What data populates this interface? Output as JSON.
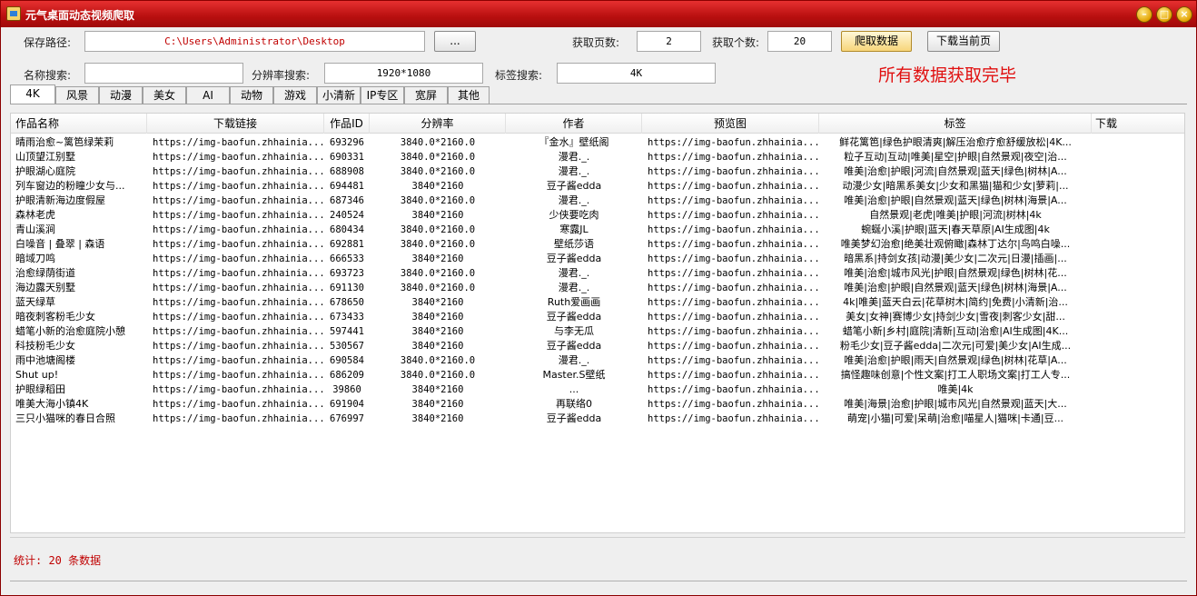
{
  "window": {
    "title": "元气桌面动态视频爬取"
  },
  "form": {
    "save_path_label": "保存路径:",
    "save_path_value": "C:\\Users\\Administrator\\Desktop",
    "browse_label": "...",
    "pages_label": "获取页数:",
    "pages_value": "2",
    "count_label": "获取个数:",
    "count_value": "20",
    "crawl_button": "爬取数据",
    "download_page_button": "下载当前页",
    "name_search_label": "名称搜索:",
    "name_search_value": "",
    "res_search_label": "分辨率搜索:",
    "res_search_value": "1920*1080",
    "tag_search_label": "标签搜索:",
    "tag_search_value": "4K",
    "status_message": "所有数据获取完毕"
  },
  "tabs": [
    "4K",
    "风景",
    "动漫",
    "美女",
    "AI",
    "动物",
    "游戏",
    "小清新",
    "IP专区",
    "宽屏",
    "其他"
  ],
  "selected_tab": "4K",
  "table": {
    "columns": [
      "作品名称",
      "下载链接",
      "作品ID",
      "分辨率",
      "作者",
      "预览图",
      "标签",
      "下载"
    ],
    "rows": [
      [
        "晴雨治愈~篱笆绿茉莉",
        "https://img-baofun.zhhainia...",
        "693296",
        "3840.0*2160.0",
        "『金水』壁纸阁",
        "https://img-baofun.zhhainia...",
        "鲜花篱笆|绿色护眼清爽|解压治愈疗愈舒缓放松|4K..."
      ],
      [
        "山顶望江别墅",
        "https://img-baofun.zhhainia...",
        "690331",
        "3840.0*2160.0",
        "漫君._.",
        "https://img-baofun.zhhainia...",
        "粒子互动|互动|唯美|星空|护眼|自然景观|夜空|治..."
      ],
      [
        "护眼湖心庭院",
        "https://img-baofun.zhhainia...",
        "688908",
        "3840.0*2160.0",
        "漫君._.",
        "https://img-baofun.zhhainia...",
        "唯美|治愈|护眼|河流|自然景观|蓝天|绿色|树林|A..."
      ],
      [
        "列车窗边的粉瞳少女与...",
        "https://img-baofun.zhhainia...",
        "694481",
        "3840*2160",
        "豆子酱edda",
        "https://img-baofun.zhhainia...",
        "动漫少女|暗黑系美女|少女和黑猫|猫和少女|萝莉|..."
      ],
      [
        "护眼清新海边度假屋",
        "https://img-baofun.zhhainia...",
        "687346",
        "3840.0*2160.0",
        "漫君._.",
        "https://img-baofun.zhhainia...",
        "唯美|治愈|护眼|自然景观|蓝天|绿色|树林|海景|A..."
      ],
      [
        "森林老虎",
        "https://img-baofun.zhhainia...",
        "240524",
        "3840*2160",
        "少侠要吃肉",
        "https://img-baofun.zhhainia...",
        "自然景观|老虎|唯美|护眼|河流|树林|4k"
      ],
      [
        "青山溪涧",
        "https://img-baofun.zhhainia...",
        "680434",
        "3840.0*2160.0",
        "寒露JL",
        "https://img-baofun.zhhainia...",
        "蜿蜒小溪|护眼|蓝天|春天草原|AI生成图|4k"
      ],
      [
        "白噪音 | 叠翠 | 森语",
        "https://img-baofun.zhhainia...",
        "692881",
        "3840.0*2160.0",
        "壁纸莎语",
        "https://img-baofun.zhhainia...",
        "唯美梦幻治愈|绝美壮观俯瞰|森林丁达尔|鸟鸣白噪..."
      ],
      [
        "暗域刀鸣",
        "https://img-baofun.zhhainia...",
        "666533",
        "3840*2160",
        "豆子酱edda",
        "https://img-baofun.zhhainia...",
        "暗黑系|持剑女孩|动漫|美少女|二次元|日漫|插画|..."
      ],
      [
        "治愈绿荫街道",
        "https://img-baofun.zhhainia...",
        "693723",
        "3840.0*2160.0",
        "漫君._.",
        "https://img-baofun.zhhainia...",
        "唯美|治愈|城市风光|护眼|自然景观|绿色|树林|花..."
      ],
      [
        "海边露天别墅",
        "https://img-baofun.zhhainia...",
        "691130",
        "3840.0*2160.0",
        "漫君._.",
        "https://img-baofun.zhhainia...",
        "唯美|治愈|护眼|自然景观|蓝天|绿色|树林|海景|A..."
      ],
      [
        "蓝天绿草",
        "https://img-baofun.zhhainia...",
        "678650",
        "3840*2160",
        "Ruth爱画画",
        "https://img-baofun.zhhainia...",
        "4k|唯美|蓝天白云|花草树木|简约|免费|小清新|治..."
      ],
      [
        "暗夜刺客粉毛少女",
        "https://img-baofun.zhhainia...",
        "673433",
        "3840*2160",
        "豆子酱edda",
        "https://img-baofun.zhhainia...",
        "美女|女神|赛博少女|持剑少女|雪夜|刺客少女|甜..."
      ],
      [
        "蜡笔小新的治愈庭院小憩",
        "https://img-baofun.zhhainia...",
        "597441",
        "3840*2160",
        "与李无瓜",
        "https://img-baofun.zhhainia...",
        "蜡笔小新|乡村|庭院|清新|互动|治愈|AI生成图|4K..."
      ],
      [
        "科技粉毛少女",
        "https://img-baofun.zhhainia...",
        "530567",
        "3840*2160",
        "豆子酱edda",
        "https://img-baofun.zhhainia...",
        "粉毛少女|豆子酱edda|二次元|可爱|美少女|AI生成..."
      ],
      [
        "雨中池塘阁楼",
        "https://img-baofun.zhhainia...",
        "690584",
        "3840.0*2160.0",
        "漫君._.",
        "https://img-baofun.zhhainia...",
        "唯美|治愈|护眼|雨天|自然景观|绿色|树林|花草|A..."
      ],
      [
        "Shut  up!",
        "https://img-baofun.zhhainia...",
        "686209",
        "3840.0*2160.0",
        "Master.S壁纸",
        "https://img-baofun.zhhainia...",
        "搞怪趣味创意|个性文案|打工人职场文案|打工人专..."
      ],
      [
        "护眼绿稻田",
        "https://img-baofun.zhhainia...",
        "39860",
        "3840*2160",
        "...",
        "https://img-baofun.zhhainia...",
        "唯美|4k"
      ],
      [
        "唯美大海小镇4K",
        "https://img-baofun.zhhainia...",
        "691904",
        "3840*2160",
        "再联络0",
        "https://img-baofun.zhhainia...",
        "唯美|海景|治愈|护眼|城市风光|自然景观|蓝天|大..."
      ],
      [
        "三只小猫咪的春日合照",
        "https://img-baofun.zhhainia...",
        "676997",
        "3840*2160",
        "豆子酱edda",
        "https://img-baofun.zhhainia...",
        "萌宠|小猫|可爱|呆萌|治愈|喵星人|猫咪|卡通|豆..."
      ]
    ]
  },
  "footer": {
    "stats": "统计: 20 条数据"
  },
  "colors": {
    "titlebar": "#c41414",
    "status_red": "#e01010",
    "stats_red": "#c00000"
  }
}
